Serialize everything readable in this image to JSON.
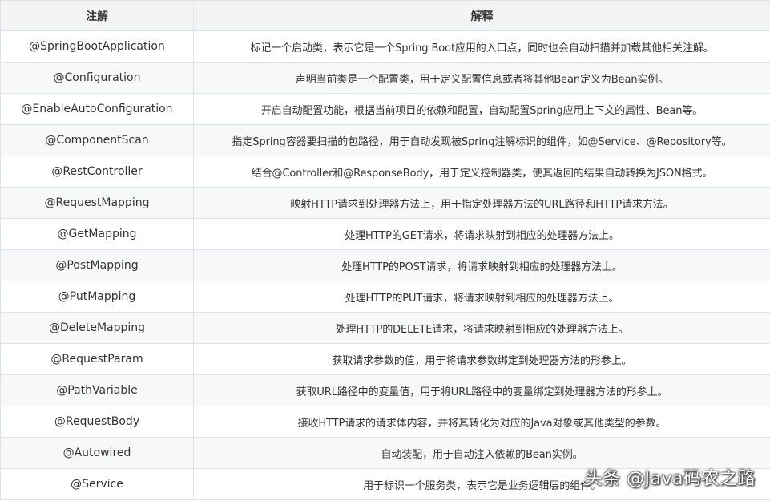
{
  "table": {
    "headers": [
      "注解",
      "解释"
    ],
    "rows": [
      {
        "annotation": "@SpringBootApplication",
        "description": "标记一个启动类，表示它是一个Spring Boot应用的入口点，同时也会自动扫描并加载其他相关注解。"
      },
      {
        "annotation": "@Configuration",
        "description": "声明当前类是一个配置类，用于定义配置信息或者将其他Bean定义为Bean实例。"
      },
      {
        "annotation": "@EnableAutoConfiguration",
        "description": "开启自动配置功能，根据当前项目的依赖和配置，自动配置Spring应用上下文的属性、Bean等。"
      },
      {
        "annotation": "@ComponentScan",
        "description": "指定Spring容器要扫描的包路径，用于自动发现被Spring注解标识的组件，如@Service、@Repository等。"
      },
      {
        "annotation": "@RestController",
        "description": "结合@Controller和@ResponseBody，用于定义控制器类，使其返回的结果自动转换为JSON格式。"
      },
      {
        "annotation": "@RequestMapping",
        "description": "映射HTTP请求到处理器方法上，用于指定处理器方法的URL路径和HTTP请求方法。"
      },
      {
        "annotation": "@GetMapping",
        "description": "处理HTTP的GET请求，将请求映射到相应的处理器方法上。"
      },
      {
        "annotation": "@PostMapping",
        "description": "处理HTTP的POST请求，将请求映射到相应的处理器方法上。"
      },
      {
        "annotation": "@PutMapping",
        "description": "处理HTTP的PUT请求，将请求映射到相应的处理器方法上。"
      },
      {
        "annotation": "@DeleteMapping",
        "description": "处理HTTP的DELETE请求，将请求映射到相应的处理器方法上。"
      },
      {
        "annotation": "@RequestParam",
        "description": "获取请求参数的值，用于将请求参数绑定到处理器方法的形参上。"
      },
      {
        "annotation": "@PathVariable",
        "description": "获取URL路径中的变量值，用于将URL路径中的变量绑定到处理器方法的形参上。"
      },
      {
        "annotation": "@RequestBody",
        "description": "接收HTTP请求的请求体内容，并将其转化为对应的Java对象或其他类型的参数。"
      },
      {
        "annotation": "@Autowired",
        "description": "自动装配，用于自动注入依赖的Bean实例。"
      },
      {
        "annotation": "@Service",
        "description": "用于标识一个服务类，表示它是业务逻辑层的组件。"
      }
    ]
  },
  "watermark": "头条 @Java码农之路"
}
